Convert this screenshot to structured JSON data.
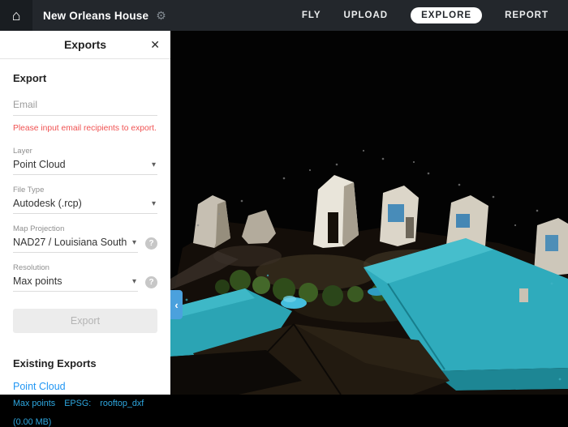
{
  "topbar": {
    "title": "New Orleans House",
    "nav": [
      {
        "label": "FLY"
      },
      {
        "label": "UPLOAD"
      },
      {
        "label": "EXPLORE",
        "active": true
      },
      {
        "label": "REPORT"
      }
    ]
  },
  "panel": {
    "title": "Exports",
    "export_heading": "Export",
    "email_placeholder": "Email",
    "error_message": "Please input email recipients to export.",
    "fields": [
      {
        "label": "Layer",
        "value": "Point Cloud"
      },
      {
        "label": "File Type",
        "value": "Autodesk (.rcp)"
      },
      {
        "label": "Map Projection",
        "value": "NAD27 / Louisiana South"
      },
      {
        "label": "Resolution",
        "value": "Max points"
      }
    ],
    "export_button": "Export",
    "existing": {
      "heading": "Existing Exports",
      "item_name": "Point Cloud",
      "parts": [
        "Max points",
        "EPSG:",
        "rooftop_dxf",
        "(0.00 MB)"
      ]
    }
  },
  "icons": {
    "home": "⌂",
    "gear": "⚙",
    "close": "✕",
    "chevron_down": "▾",
    "help": "?",
    "collapse": "‹"
  },
  "colors": {
    "topbar_bg": "#23272c",
    "accent_blue": "#2196f3",
    "details_blue": "#2ea7e0",
    "error_red": "#f05252",
    "collapse_tab": "#4ba1dd",
    "roof_teal": "#2fabbc"
  }
}
